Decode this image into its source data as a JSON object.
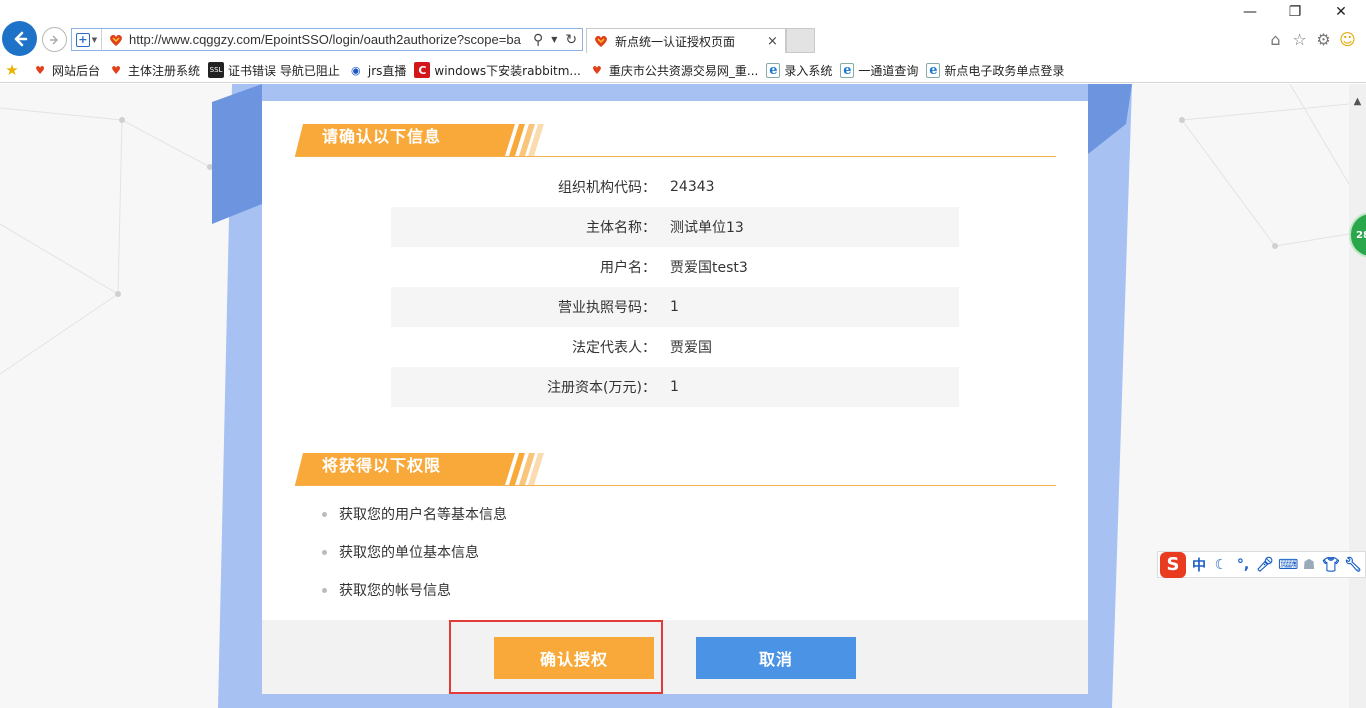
{
  "browser": {
    "url": "http://www.cqggzy.com/EpointSSO/login/oauth2authorize?scope=ba",
    "tab_title": "新点统一认证授权页面",
    "tab_close": "×"
  },
  "favorites": [
    {
      "label": "网站后台",
      "icon": "heart-icon"
    },
    {
      "label": "主体注册系统",
      "icon": "heart-icon"
    },
    {
      "label": "证书错误 导航已阻止",
      "icon": "ssl-icon"
    },
    {
      "label": "jrs直播",
      "icon": "jrs-icon"
    },
    {
      "label": "windows下安装rabbitm...",
      "icon": "c-icon"
    },
    {
      "label": "重庆市公共资源交易网_重...",
      "icon": "heart-icon"
    },
    {
      "label": "录入系统",
      "icon": "ie-icon"
    },
    {
      "label": "一通道查询",
      "icon": "ie-icon"
    },
    {
      "label": "新点电子政务单点登录",
      "icon": "ie-icon"
    }
  ],
  "confirm_section": {
    "title": "请确认以下信息",
    "rows": [
      {
        "label": "组织机构代码：",
        "value": "24343"
      },
      {
        "label": "主体名称：",
        "value": "测试单位13"
      },
      {
        "label": "用户名：",
        "value": "贾爱国test3"
      },
      {
        "label": "营业执照号码：",
        "value": "1"
      },
      {
        "label": "法定代表人：",
        "value": "贾爱国"
      },
      {
        "label": "注册资本(万元)：",
        "value": "1"
      }
    ]
  },
  "permission_section": {
    "title": "将获得以下权限",
    "items": [
      "获取您的用户名等基本信息",
      "获取您的单位基本信息",
      "获取您的帐号信息"
    ]
  },
  "actions": {
    "confirm_label": "确认授权",
    "cancel_label": "取消"
  },
  "side_badge": "28",
  "ime": {
    "logo": "S",
    "mode": "中"
  },
  "colors": {
    "accent_orange": "#f8a93a",
    "accent_blue": "#4b93e5",
    "highlight_red": "#e33a3a",
    "browser_blue": "#1e73c9"
  }
}
